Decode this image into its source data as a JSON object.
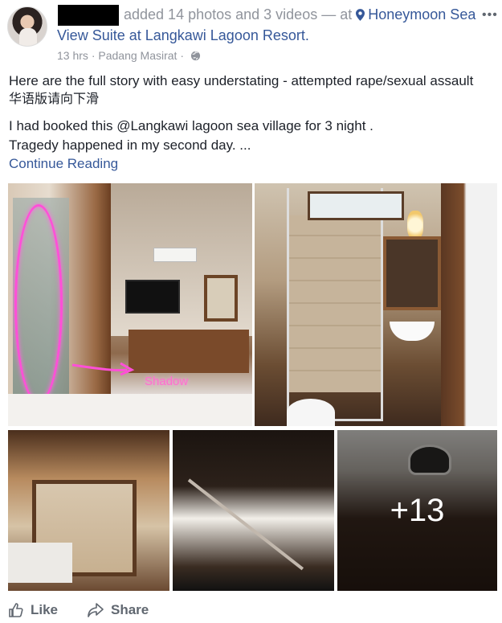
{
  "post": {
    "actor_action": "added 14 photos and 3 videos",
    "at_sep": "— at",
    "location_line1": "Honeymoon Sea",
    "location_line2": "View Suite at Langkawi Lagoon Resort.",
    "time": "13 hrs",
    "meta_sep": "·",
    "place": "Padang Masirat",
    "more_icon": "•••",
    "text_line1": "Here are the full story with easy understating - attempted rape/sexual assault",
    "text_line2": "华语版请向下滑",
    "text_line3": "I had booked this @Langkawi lagoon sea village for 3 night .",
    "text_line4": "Tragedy happened in my second day. ...",
    "continue": "Continue Reading"
  },
  "photos": {
    "shadow_label": "Shadow",
    "more_count": "+13"
  },
  "actions": {
    "like": "Like",
    "share": "Share"
  },
  "icons": {
    "location": "location-pin-icon",
    "privacy": "globe-icon",
    "like": "thumbs-up-icon",
    "share": "share-arrow-icon"
  },
  "colors": {
    "link": "#365899",
    "meta": "#90949c",
    "text": "#1d2129",
    "annotation": "#ff4fd8"
  }
}
